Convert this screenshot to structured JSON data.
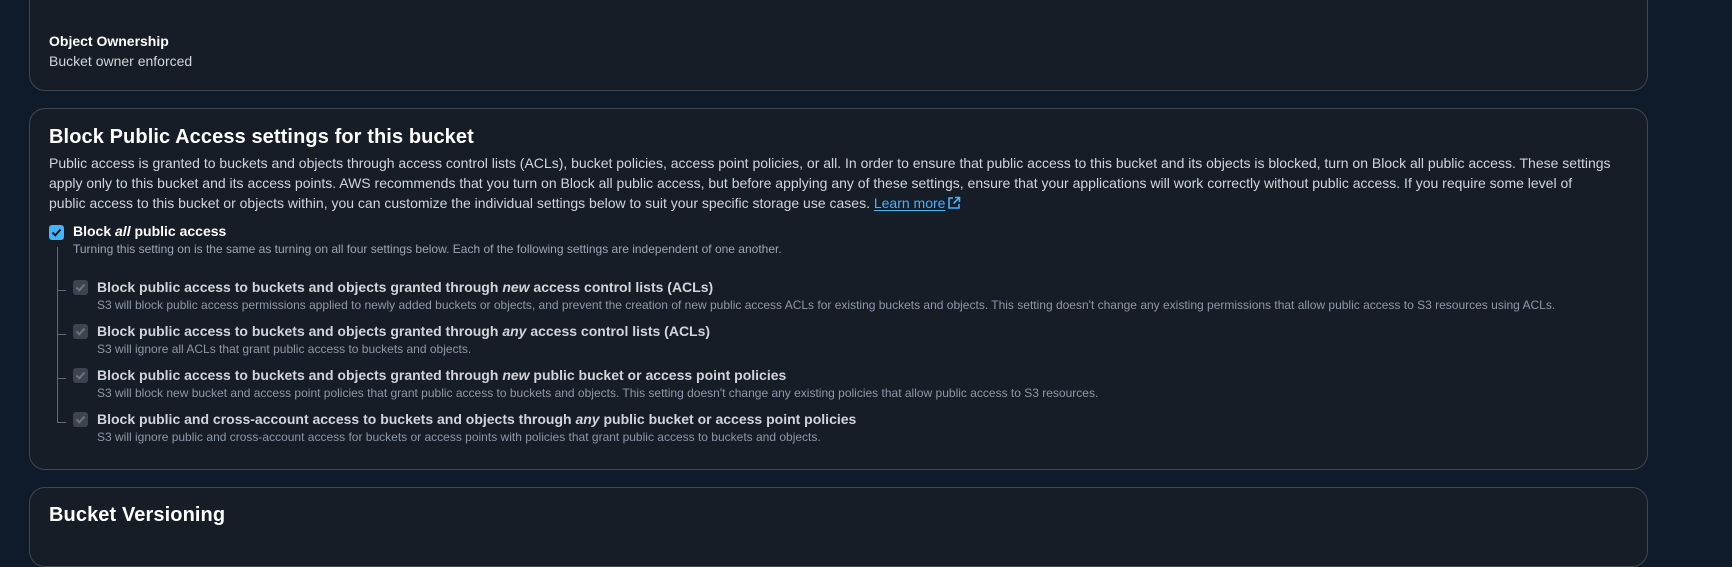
{
  "ownership": {
    "label": "Object Ownership",
    "value": "Bucket owner enforced"
  },
  "block_public_access": {
    "title": "Block Public Access settings for this bucket",
    "description_line1": "Public access is granted to buckets and objects through access control lists (ACLs), bucket policies, access point policies, or all. In order to ensure that public access to this bucket and its objects is blocked, turn on Block all public access. These settings",
    "description_line2": "apply only to this bucket and its access points. AWS recommends that you turn on Block all public access, but before applying any of these settings, ensure that your applications will work correctly without public access. If you require some level of",
    "description_line3": "public access to this bucket or objects within, you can customize the individual settings below to suit your specific storage use cases. ",
    "learn_more": "Learn more",
    "block_all": {
      "prefix": "Block ",
      "emphasis": "all",
      "suffix": " public access",
      "description": "Turning this setting on is the same as turning on all four settings below. Each of the following settings are independent of one another.",
      "checked": true
    },
    "options": [
      {
        "prefix": "Block public access to buckets and objects granted through ",
        "emphasis": "new",
        "suffix": " access control lists (ACLs)",
        "description": "S3 will block public access permissions applied to newly added buckets or objects, and prevent the creation of new public access ACLs for existing buckets and objects. This setting doesn't change any existing permissions that allow public access to S3 resources using ACLs.",
        "checked": true
      },
      {
        "prefix": "Block public access to buckets and objects granted through ",
        "emphasis": "any",
        "suffix": " access control lists (ACLs)",
        "description": "S3 will ignore all ACLs that grant public access to buckets and objects.",
        "checked": true
      },
      {
        "prefix": "Block public access to buckets and objects granted through ",
        "emphasis": "new",
        "suffix": " public bucket or access point policies",
        "description": "S3 will block new bucket and access point policies that grant public access to buckets and objects. This setting doesn't change any existing policies that allow public access to S3 resources.",
        "checked": true
      },
      {
        "prefix": "Block public and cross-account access to buckets and objects through ",
        "emphasis": "any",
        "suffix": " public bucket or access point policies",
        "description": "S3 will ignore public and cross-account access for buckets or access points with policies that grant public access to buckets and objects.",
        "checked": true
      }
    ]
  },
  "versioning": {
    "title": "Bucket Versioning"
  },
  "icons": {
    "checkbox": "checkmark-icon",
    "external_link": "external-link-icon"
  },
  "colors": {
    "accent": "#42b4ff",
    "panel_bg": "#161d26",
    "page_bg": "#0f1b2a"
  }
}
